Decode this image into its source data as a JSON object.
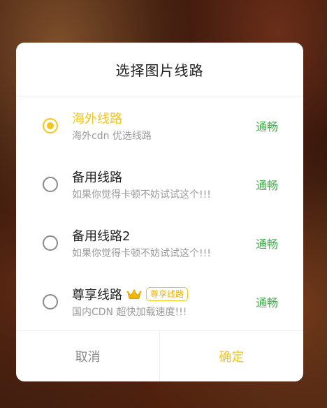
{
  "dialog": {
    "title": "选择图片线路",
    "options": [
      {
        "name": "海外线路",
        "desc": "海外cdn 优选线路",
        "status": "通畅",
        "selected": true
      },
      {
        "name": "备用线路",
        "desc": "如果你觉得卡顿不妨试试这个!!!",
        "status": "通畅",
        "selected": false
      },
      {
        "name": "备用线路2",
        "desc": "如果你觉得卡顿不妨试试这个!!!",
        "status": "通畅",
        "selected": false
      },
      {
        "name": "尊享线路",
        "badge": "尊享线路",
        "desc": "国内CDN 超快加载速度!!!",
        "status": "通畅",
        "selected": false,
        "icon": "crown-icon"
      }
    ],
    "cancel_label": "取消",
    "confirm_label": "确定"
  },
  "colors": {
    "accent": "#f5c518",
    "status_ok": "#3fae48",
    "muted": "#9a9a9a"
  }
}
